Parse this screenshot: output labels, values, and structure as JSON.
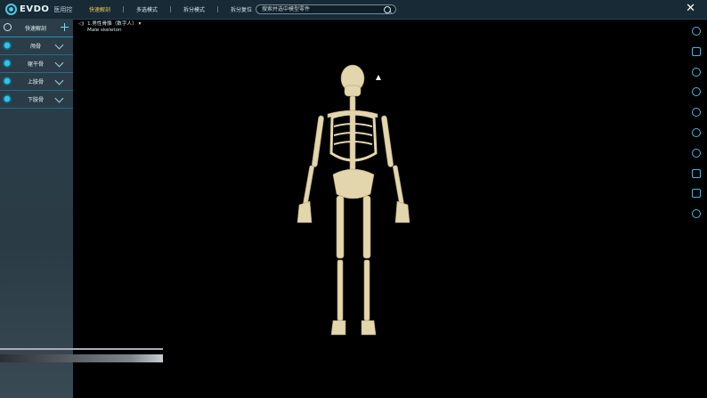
{
  "app": {
    "logo_text": "EVDO",
    "logo_sub": "医用控"
  },
  "tabs": [
    {
      "label": "快速解剖",
      "active": true
    },
    {
      "label": "多选模式",
      "active": false
    },
    {
      "label": "拆分模式",
      "active": false
    },
    {
      "label": "拆分复位",
      "active": false
    }
  ],
  "search": {
    "placeholder": "搜索并选中模型零件"
  },
  "left_panel": {
    "header_label": "快速解剖",
    "items": [
      {
        "label": "颅骨"
      },
      {
        "label": "躯干骨"
      },
      {
        "label": "上肢骨"
      },
      {
        "label": "下肢骨"
      }
    ]
  },
  "model_info": {
    "title_cn": "1.男性骨骼（数字人）",
    "title_en": "Male skeleton"
  },
  "right_toolbar": [
    "share-icon",
    "vr-icon",
    "star-icon",
    "chart-icon",
    "palette-icon",
    "focus-icon",
    "rotate-icon",
    "fullscreen-icon",
    "screen-icon",
    "home-icon"
  ],
  "colors": {
    "accent": "#2ec4e6",
    "active_tab": "#f2c94c",
    "bone": "#e7dcb6",
    "panel": "#2b3d48"
  }
}
